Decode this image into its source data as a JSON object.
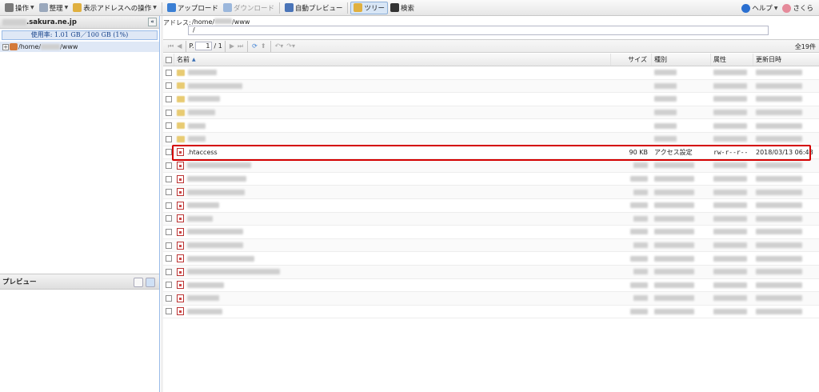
{
  "toolbar": {
    "items": [
      {
        "label": "操作",
        "icon": "gear-icon",
        "color": "#7a7a7a",
        "caret": true
      },
      {
        "label": "整理",
        "icon": "organize-icon",
        "color": "#9aa8bc",
        "caret": true
      },
      {
        "label": "表示アドレスへの操作",
        "icon": "folder-action-icon",
        "color": "#e0b040",
        "caret": true
      },
      {
        "label": "アップロード",
        "icon": "upload-icon",
        "color": "#3b7fd4",
        "caret": false
      },
      {
        "label": "ダウンロード",
        "icon": "download-icon",
        "color": "#9bb7dc",
        "caret": false,
        "disabled": true
      },
      {
        "label": "自動プレビュー",
        "icon": "monitor-icon",
        "color": "#4a74b8",
        "caret": false
      },
      {
        "label": "ツリー",
        "icon": "tree-icon",
        "color": "#e0b040",
        "caret": false,
        "pressed": true
      },
      {
        "label": "検索",
        "icon": "binoculars-icon",
        "color": "#333333",
        "caret": false
      }
    ],
    "help_label": "ヘルプ",
    "user_label": "さくら"
  },
  "left": {
    "domain_suffix": ".sakura.ne.jp",
    "usage": "使用率: 1.01 GB／100 GB (1%)",
    "tree_root_prefix": "/home/",
    "tree_root_suffix": "/www",
    "preview_title": "プレビュー"
  },
  "address": {
    "label": "アドレス:",
    "path_prefix": "/home/",
    "path_suffix": "/www",
    "input_value": "/"
  },
  "pager": {
    "page_label": "P.",
    "page_value": "1",
    "page_total": "/ 1",
    "total": "全19件"
  },
  "columns": {
    "name": "名前",
    "size": "サイズ",
    "kind": "種別",
    "attr": "属性",
    "date": "更新日時"
  },
  "files": [
    {
      "type": "folder",
      "name_w": 36
    },
    {
      "type": "folder",
      "name_w": 68
    },
    {
      "type": "folder",
      "name_w": 40
    },
    {
      "type": "folder",
      "name_w": 34
    },
    {
      "type": "folder",
      "name_w": 22
    },
    {
      "type": "folder",
      "name_w": 22
    },
    {
      "type": "file",
      "name": ".htaccess",
      "size": "90 KB",
      "kind": "アクセス設定",
      "attr": "rw-r--r--",
      "date": "2018/03/13 06:48",
      "highlight": true
    },
    {
      "type": "file",
      "name_w": 80
    },
    {
      "type": "file",
      "name_w": 74
    },
    {
      "type": "file",
      "name_w": 72
    },
    {
      "type": "file",
      "name_w": 40
    },
    {
      "type": "file",
      "name_w": 32
    },
    {
      "type": "file",
      "name_w": 70
    },
    {
      "type": "file",
      "name_w": 70
    },
    {
      "type": "file",
      "name_w": 84
    },
    {
      "type": "file",
      "name_w": 116
    },
    {
      "type": "file",
      "name_w": 46
    },
    {
      "type": "file",
      "name_w": 40
    },
    {
      "type": "file",
      "name_w": 44
    }
  ]
}
